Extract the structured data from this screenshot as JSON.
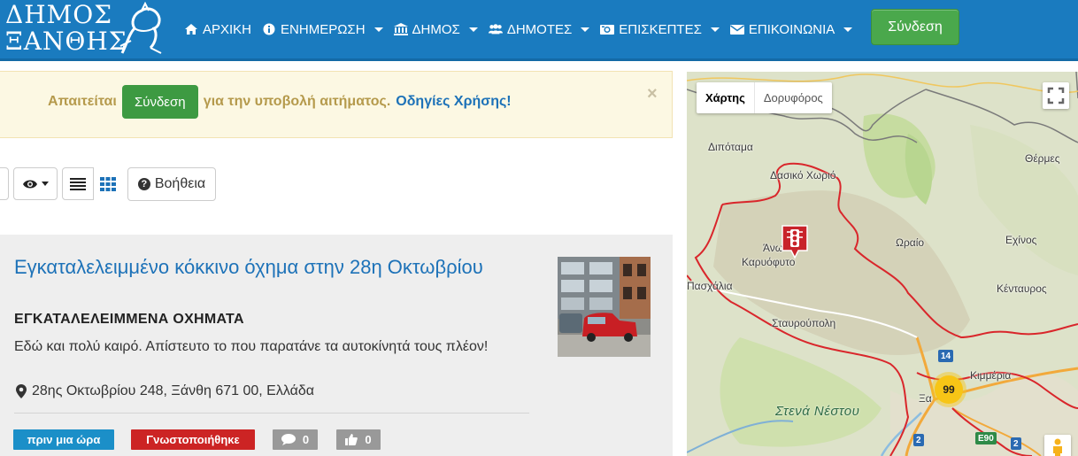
{
  "logo": {
    "line1": "ΔΗΜΟΣ",
    "line2": "ΞΑΝΘΗΣ"
  },
  "nav": {
    "items": [
      {
        "label": "ΑΡΧΙΚΗ",
        "icon": "home-icon",
        "dropdown": false
      },
      {
        "label": "ΕΝΗΜΕΡΩΣΗ",
        "icon": "info-icon",
        "dropdown": true
      },
      {
        "label": "ΔΗΜΟΣ",
        "icon": "institution-icon",
        "dropdown": true
      },
      {
        "label": "ΔΗΜΟΤΕΣ",
        "icon": "users-icon",
        "dropdown": true
      },
      {
        "label": "ΕΠΙΣΚΕΠΤΕΣ",
        "icon": "camera-icon",
        "dropdown": true
      },
      {
        "label": "ΕΠΙΚΟΙΝΩΝΙΑ",
        "icon": "envelope-icon",
        "dropdown": true
      }
    ],
    "login_label": "Σύνδεση"
  },
  "alert": {
    "prefix": "Απαιτείται",
    "button_label": "Σύνδεση",
    "suffix": "για την υποβολή αιτήματος.",
    "link_label": "Οδηγίες Χρήσης!",
    "close": "×"
  },
  "toolbar": {
    "help_label": "Βοήθεια"
  },
  "card": {
    "title": "Εγκαταλελειμμένο κόκκινο όχημα στην 28η Οκτωβρίου",
    "category": "ΕΓΚΑΤΑΛΕΛΕΙΜΜΕΝΑ ΟΧΗΜΑΤΑ",
    "description": "Εδώ και πολύ καιρό. Απίστευτο το που παρατάνε τα αυτοκίνητά τους πλέον!",
    "address": "28ης Οκτωβρίου 248, Ξάνθη 671 00, Ελλάδα",
    "time": "πριν μια ώρα",
    "status": "Γνωστοποιήθηκε",
    "comments": "0",
    "likes": "0"
  },
  "map": {
    "type_map": "Χάρτης",
    "type_satellite": "Δορυφόρος",
    "places": {
      "dipotama": "Διπόταμα",
      "dasiko": "Δασικό Χωριό",
      "thermes": "Θέρμες",
      "ano": "Άνω",
      "karyofyto": "Καρυόφυτο",
      "oraio": "Ωραίο",
      "exinos": "Εχίνος",
      "paschalia": "Πασχάλια",
      "kentavros": "Κένταυρος",
      "stavroupoli": "Σταυρούπολη",
      "kimmeria": "Κιμμέρια",
      "xa": "Ξα"
    },
    "region_label": "Στενά Νέστου",
    "cluster_count": "99",
    "shields": {
      "r14": "14",
      "r2a": "2",
      "r2b": "2",
      "e90": "E90"
    }
  },
  "colors": {
    "navbar": "#1a7bbf",
    "login_green": "#4aa84c",
    "alert_bg": "#fcf8e3",
    "link_blue": "#1d72b8",
    "badge_time": "#1b8fc8",
    "badge_status": "#cc2424",
    "badge_gray": "#999999",
    "map_border": "#d9262b",
    "cluster": "#f7c516"
  }
}
